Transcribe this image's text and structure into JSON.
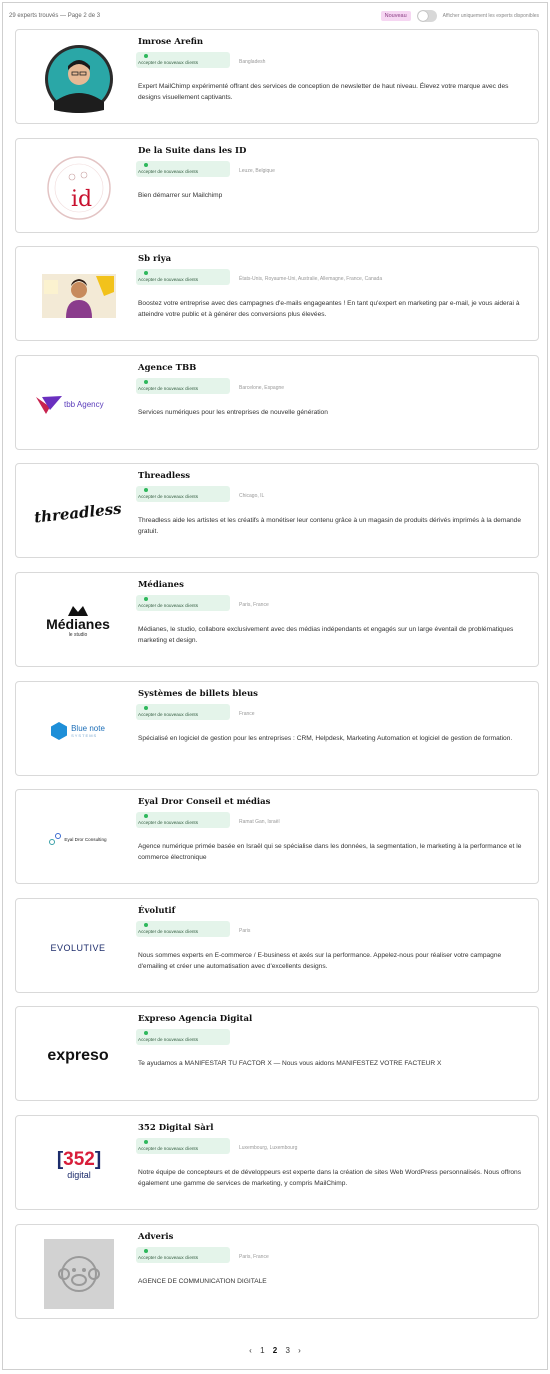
{
  "header": {
    "results_text": "29 experts trouvés — Page 2 de 3",
    "new_badge": "Nouveau",
    "toggle_label": "Afficher uniquement les experts disponibles"
  },
  "status_text": "Accepter de nouveaux clients",
  "experts": [
    {
      "name": "Imrose Arefin",
      "location": "Bangladesh",
      "logo": "portrait-photo",
      "description": "Expert MailChimp expérimenté offrant des services de conception de newsletter de haut niveau. Élevez votre marque avec des designs visuellement captivants."
    },
    {
      "name": "De la Suite dans les ID",
      "location": "Leuze, Belgique",
      "logo": "suite-id-logo",
      "logo_text": "id",
      "description": "Bien démarrer sur Mailchimp"
    },
    {
      "name": "Sb riya",
      "location": "États-Unis, Royaume-Uni, Australie, Allemagne, France, Canada",
      "logo": "riya-photo",
      "description": "Boostez votre entreprise avec des campagnes d'e-mails engageantes ! En tant qu'expert en marketing par e-mail, je vous aiderai à atteindre votre public et à générer des conversions plus élevées."
    },
    {
      "name": "Agence TBB",
      "location": "Barcelone, Espagne",
      "logo": "tbb-logo",
      "logo_text": "tbb Agency",
      "description": "Services numériques pour les entreprises de nouvelle génération"
    },
    {
      "name": "Threadless",
      "location": "Chicago, IL",
      "logo": "threadless-logo",
      "logo_text": "threadless",
      "description": "Threadless aide les artistes et les créatifs à monétiser leur contenu grâce à un magasin de produits dérivés imprimés à la demande gratuit."
    },
    {
      "name": "Médianes",
      "location": "Paris, France",
      "logo": "medianes-logo",
      "logo_text": "Médianes",
      "logo_subtext": "le studio",
      "description": "Médianes, le studio, collabore exclusivement avec des médias indépendants et engagés sur un large éventail de problématiques marketing et design."
    },
    {
      "name": "Systèmes de billets bleus",
      "location": "France",
      "logo": "bluenote-logo",
      "logo_text": "Blue note",
      "logo_subtext": "SYSTEMS",
      "description": "Spécialisé en logiciel de gestion pour les entreprises : CRM, Helpdesk, Marketing Automation et logiciel de gestion de formation."
    },
    {
      "name": "Eyal Dror Conseil et médias",
      "location": "Ramat Gan, Israël",
      "logo": "eyal-dror-logo",
      "logo_text": "Eyal Dror Consulting",
      "description": "Agence numérique primée basée en Israël qui se spécialise dans les données, la segmentation, le marketing à la performance et le commerce électronique"
    },
    {
      "name": "Évolutif",
      "location": "Paris",
      "logo": "evolutive-logo",
      "logo_text": "EVOLUTIVE",
      "description": "Nous sommes experts en E-commerce / E-business et axés sur la performance. Appelez-nous pour réaliser votre campagne d'emailing et créer une automatisation avec d'excellents designs."
    },
    {
      "name": "Expreso Agencia Digital",
      "location": "",
      "logo": "expreso-logo",
      "logo_text": "expreso",
      "description": "Te ayudamos a MANIFESTAR TU FACTOR X — Nous vous aidons MANIFESTEZ VOTRE FACTEUR X"
    },
    {
      "name": "352 Digital Sàrl",
      "location": "Luxembourg, Luxembourg",
      "logo": "352-digital-logo",
      "logo_text": "352",
      "logo_subtext": "digital",
      "description": "Notre équipe de concepteurs et de développeurs est experte dans la création de sites Web WordPress personnalisés. Nous offrons également une gamme de services de marketing, y compris MailChimp."
    },
    {
      "name": "Adveris",
      "location": "Paris, France",
      "logo": "adveris-logo",
      "description": "AGENCE DE COMMUNICATION DIGITALE"
    }
  ],
  "pagination": {
    "prev": "‹",
    "pages": [
      "1",
      "2",
      "3"
    ],
    "next": "›"
  },
  "colors": {
    "status_bg": "#e4f4ea",
    "status_dot": "#2eb85c",
    "badge_bg": "#f6d6f2"
  }
}
